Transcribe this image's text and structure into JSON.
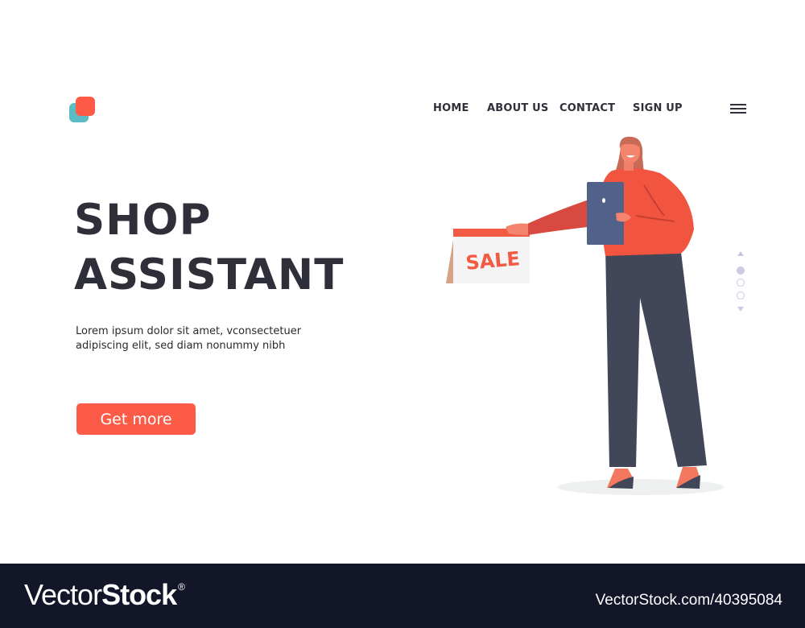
{
  "header": {
    "logo": {
      "name": "brand-logo",
      "colors": {
        "back": "#5bbcc4",
        "front": "#fc5a45"
      }
    },
    "nav": [
      {
        "label": "HOME"
      },
      {
        "label": "ABOUT US"
      },
      {
        "label": "CONTACT"
      },
      {
        "label": "SIGN UP"
      }
    ],
    "menu_icon": "hamburger-menu-icon"
  },
  "hero": {
    "title_line1": "SHOP",
    "title_line2": "ASSISTANT",
    "description": "Lorem ipsum dolor sit amet, vconsectetuer adipiscing elit, sed diam nonummy nibh",
    "cta_label": "Get more",
    "accent_color": "#fc5b48",
    "text_color": "#2f2f3a"
  },
  "illustration": {
    "subject": "woman shop assistant holding tablet and sale sign",
    "sign_text": "SALE"
  },
  "pager": {
    "total": 3,
    "active": 1,
    "up_icon": "arrow-up-icon",
    "down_icon": "arrow-down-icon"
  },
  "footer": {
    "brand_thin": "Vector",
    "brand_bold": "Stock",
    "brand_mark": "®",
    "url": "VectorStock.com/40395084"
  }
}
